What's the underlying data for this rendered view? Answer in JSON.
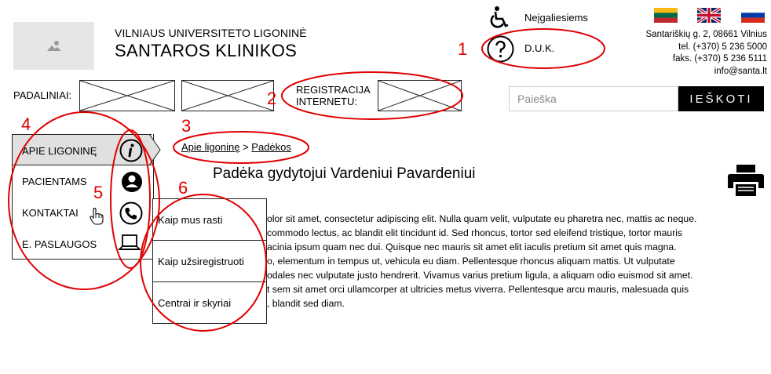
{
  "header": {
    "institution_subtitle": "VILNIAUS UNIVERSITETO LIGONINĖ",
    "institution_title": "SANTAROS KLINIKOS",
    "accessibility_label": "Neįgaliesiems",
    "faq_label": "D.U.K.",
    "flags": [
      "lithuanian-flag",
      "english-flag",
      "russian-flag"
    ],
    "address_lines": [
      "Santariškių g. 2, 08661 Vilnius",
      "tel. (+370) 5 236 5000",
      "faks. (+370) 5 236 5111",
      "info@santa.lt"
    ]
  },
  "toolbar": {
    "departments_label": "PADALINIAI:",
    "registration_line1": "REGISTRACIJA",
    "registration_line2": "INTERNETU:",
    "search_placeholder": "Paieška",
    "search_button": "IEŠKOTI"
  },
  "nav": {
    "items": [
      {
        "label": "APIE LIGONINĘ",
        "icon": "info-icon",
        "active": true
      },
      {
        "label": "PACIENTAMS",
        "icon": "user-icon"
      },
      {
        "label": "KONTAKTAI",
        "icon": "phone-icon"
      },
      {
        "label": "E. PASLAUGOS",
        "icon": "laptop-icon"
      }
    ]
  },
  "dropdown": {
    "items": [
      "Kaip mus rasti",
      "Kaip užsiregistruoti",
      "Centrai ir skyriai"
    ]
  },
  "breadcrumb": {
    "items": [
      "Apie ligoninę",
      "Padėkos"
    ],
    "separator": ">"
  },
  "main": {
    "title": "Padėka gydytojui Vardeniui Pavardeniui",
    "paragraph_lines": [
      "olor sit amet, consectetur adipiscing elit. Nulla quam velit, vulputate eu pharetra nec, mattis ac neque.",
      "commodo lectus, ac blandit elit tincidunt id. Sed rhoncus, tortor sed eleifend tristique, tortor mauris",
      "acinia ipsum quam nec dui. Quisque nec mauris sit amet elit iaculis pretium sit amet quis magna.",
      "o, elementum in tempus ut, vehicula eu diam. Pellentesque rhoncus aliquam mattis. Ut vulputate",
      "odales nec vulputate justo hendrerit. Vivamus varius pretium ligula, a aliquam odio euismod sit amet.",
      "t sem sit amet orci ullamcorper at ultricies metus viverra. Pellentesque arcu mauris, malesuada quis",
      ", blandit sed diam."
    ]
  },
  "annotations": {
    "labels": [
      "1",
      "2",
      "3",
      "4",
      "5",
      "6"
    ],
    "color": "#e00000"
  }
}
